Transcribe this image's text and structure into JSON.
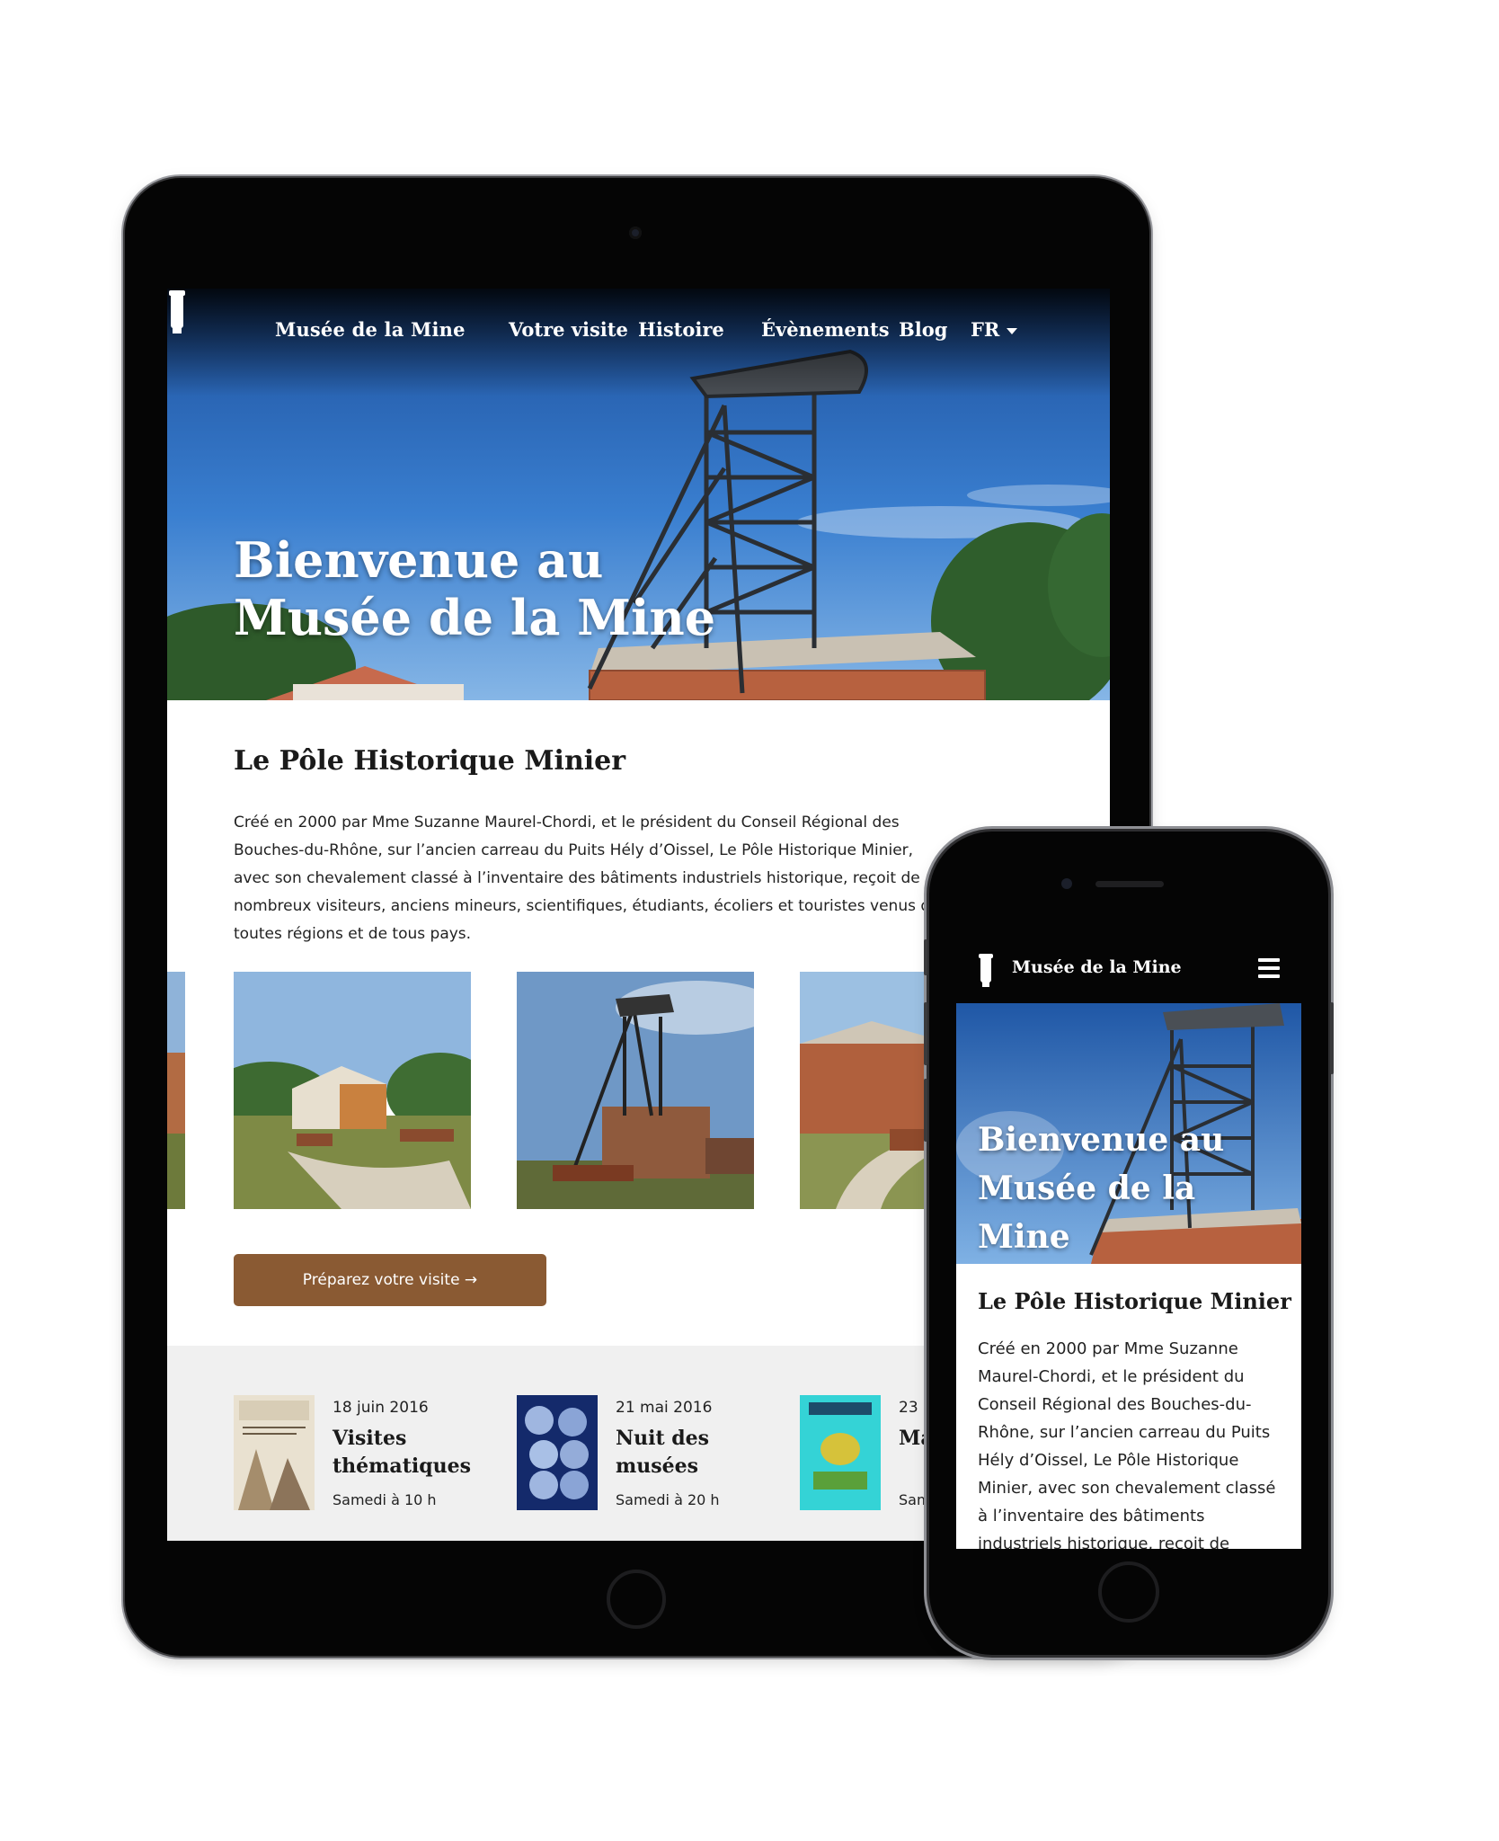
{
  "brand": "Musée de la Mine",
  "nav": {
    "items": [
      "Votre visite",
      "Histoire",
      "Évènements",
      "Blog"
    ],
    "language": "FR"
  },
  "hero": {
    "title_line1": "Bienvenue au",
    "title_line2": "Musée de la Mine"
  },
  "intro": {
    "title": "Le Pôle Historique Minier",
    "text": "Créé en 2000 par Mme Suzanne Maurel-Chordi, et le président du Conseil Régional des Bouches-du-Rhône, sur l’ancien carreau du Puits Hély d’Oissel, Le Pôle Historique Minier, avec son chevalement classé à l’inventaire des bâtiments industriels historique, reçoit de nombreux visiteurs, anciens mineurs, scientifiques, étudiants, écoliers et touristes venus de toutes régions et de tous pays."
  },
  "cta": {
    "label": "Préparez votre visite →"
  },
  "events": [
    {
      "date": "18 juin 2016",
      "title": "Visites thématiques",
      "time": "Samedi à 10 h"
    },
    {
      "date": "21 mai 2016",
      "title": "Nuit des musées",
      "time": "Samedi à 20 h"
    },
    {
      "date": "23 a",
      "title": "Mar pop",
      "time": "Sam"
    }
  ],
  "colors": {
    "accent": "#8a5a33",
    "sky": "#2f6fc4",
    "brick": "#a85a3a"
  }
}
